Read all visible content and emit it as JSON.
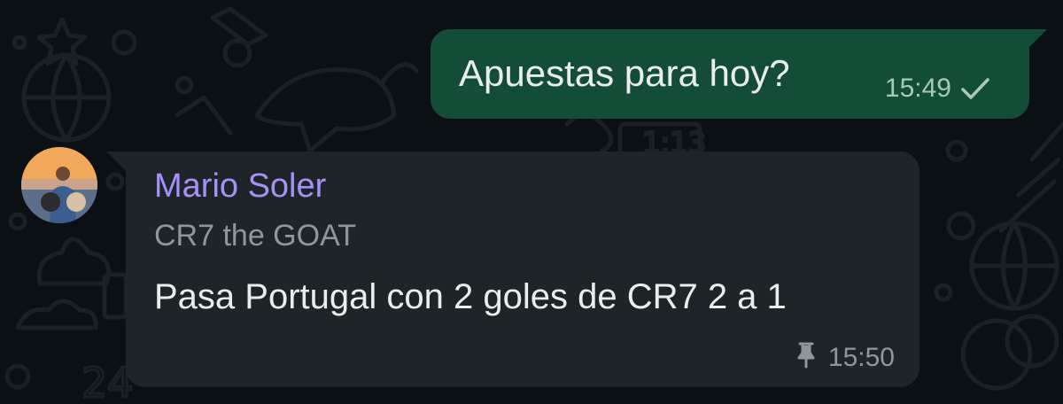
{
  "messages": {
    "outgoing": {
      "text": "Apuestas para hoy?",
      "time": "15:49",
      "status_icon": "single-check-icon"
    },
    "incoming": {
      "sender": "Mario Soler",
      "sender_status": "CR7 the GOAT",
      "text": "Pasa Portugal con 2 goles de CR7 2 a 1",
      "time": "15:50",
      "pinned_icon": "pin-icon"
    }
  },
  "colors": {
    "background": "#0b1014",
    "outgoing_bubble": "#144d37",
    "incoming_bubble": "#1e2529",
    "sender_name": "#a791f8",
    "primary_text": "#e9edef",
    "secondary_text": "#8f979b"
  }
}
